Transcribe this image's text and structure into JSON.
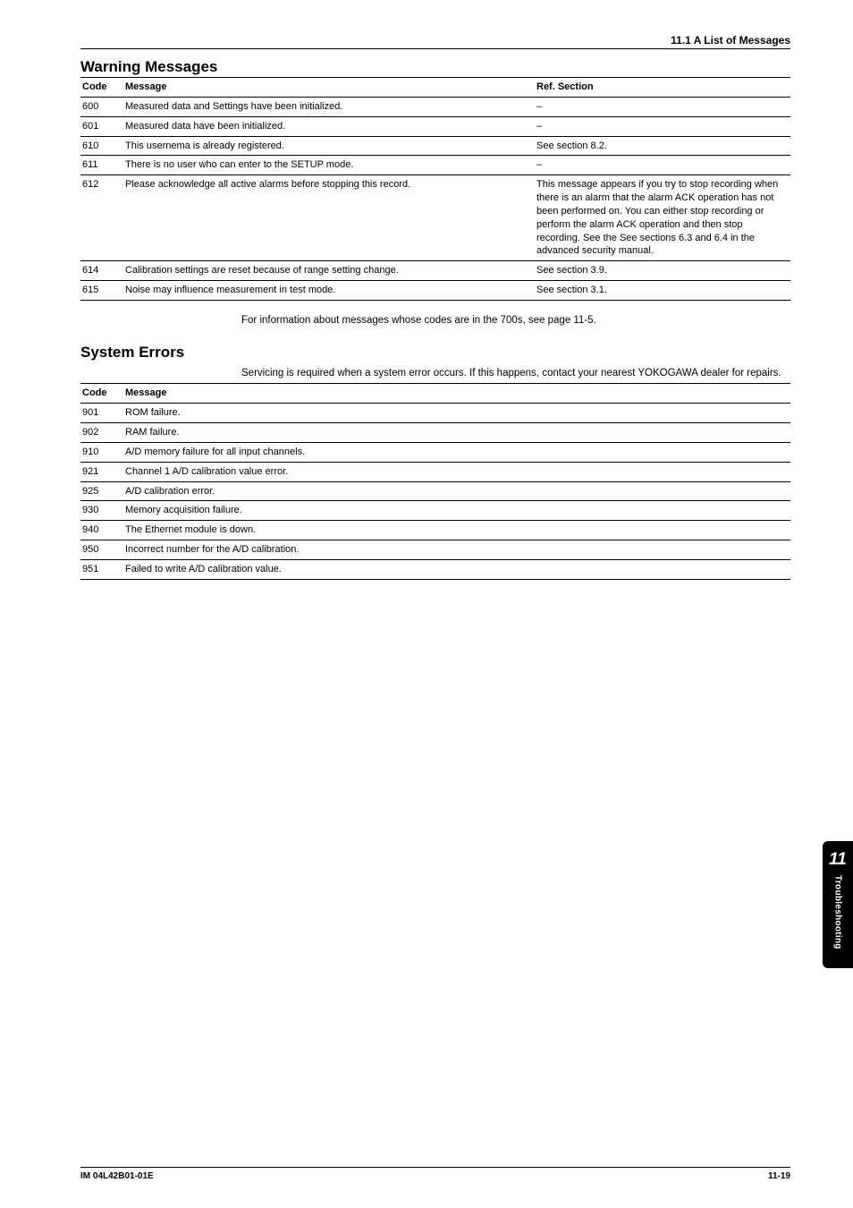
{
  "header": {
    "section_label": "11.1  A List of Messages"
  },
  "warning": {
    "title": "Warning Messages",
    "col_code": "Code",
    "col_msg": "Message",
    "col_ref": "Ref. Section",
    "rows": [
      {
        "code": "600",
        "msg": "Measured data and Settings have been initialized.",
        "ref": "–"
      },
      {
        "code": "601",
        "msg": "Measured data have been initialized.",
        "ref": "–"
      },
      {
        "code": "610",
        "msg": "This usernema is already registered.",
        "ref": "See section 8.2."
      },
      {
        "code": "611",
        "msg": "There is no user who can enter to the SETUP mode.",
        "ref": "–"
      },
      {
        "code": "612",
        "msg": "Please acknowledge all active alarms before stopping this record.",
        "ref": "This message appears if you try to stop recording when there is an alarm that the alarm ACK operation has not been performed on. You can either stop recording or perform the alarm ACK operation and then stop recording. See the See sections 6.3 and 6.4 in the advanced security manual."
      },
      {
        "code": "614",
        "msg": "Calibration settings are reset because of range setting change.",
        "ref": "See section 3.9."
      },
      {
        "code": "615",
        "msg": "Noise may influence measurement in test mode.",
        "ref": "See section 3.1."
      }
    ],
    "footnote": "For information about messages whose codes are in the 700s, see page 11-5."
  },
  "system": {
    "title": "System Errors",
    "intro": "Servicing is required when a system error occurs. If this happens, contact your nearest YOKOGAWA dealer for repairs.",
    "col_code": "Code",
    "col_msg": "Message",
    "rows": [
      {
        "code": "901",
        "msg": "ROM failure."
      },
      {
        "code": "902",
        "msg": "RAM failure."
      },
      {
        "code": "910",
        "msg": "A/D memory failure for all input channels."
      },
      {
        "code": "921",
        "msg": "Channel 1 A/D calibration value error."
      },
      {
        "code": "925",
        "msg": "A/D calibration error."
      },
      {
        "code": "930",
        "msg": "Memory acquisition failure."
      },
      {
        "code": "940",
        "msg": "The Ethernet module is down."
      },
      {
        "code": "950",
        "msg": "Incorrect number for the A/D calibration."
      },
      {
        "code": "951",
        "msg": "Failed to write A/D calibration value."
      }
    ]
  },
  "sidetab": {
    "num": "11",
    "label": "Troubleshooting"
  },
  "footer": {
    "left": "IM 04L42B01-01E",
    "right": "11-19"
  }
}
